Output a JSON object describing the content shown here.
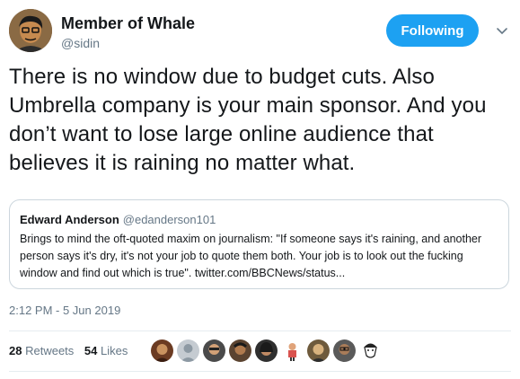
{
  "author": {
    "name": "Member of Whale",
    "handle": "@sidin",
    "follow_label": "Following"
  },
  "tweet": {
    "text": "There is no window due to budget cuts. Also Umbrella company is your main sponsor. And you don’t want to lose large online audience that believes it is raining no matter what."
  },
  "quoted": {
    "name": "Edward Anderson",
    "handle": "@edanderson101",
    "text": "Brings to mind the oft-quoted maxim on journalism: \"If someone says it's raining, and another person says it's dry, it's not your job to quote them both. Your job is to look out the fucking window and find out which is true\". twitter.com/BBCNews/status..."
  },
  "timestamp": "2:12 PM - 5 Jun 2019",
  "stats": {
    "retweets_count": "28",
    "retweets_label": "Retweets",
    "likes_count": "54",
    "likes_label": "Likes"
  },
  "colors": {
    "accent": "#1da1f2",
    "muted": "#657786",
    "border": "#ccd6dd"
  },
  "icons": {
    "caret": "chevron-down-icon"
  }
}
